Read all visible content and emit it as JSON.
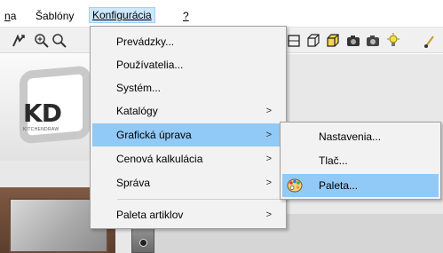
{
  "menubar": {
    "items": [
      {
        "label": "na",
        "underline": "n"
      },
      {
        "label": "Šablóny",
        "underline": "b"
      },
      {
        "label": "Konfigurácia",
        "underline": "K"
      },
      {
        "label": "?",
        "underline": "?"
      }
    ]
  },
  "toolbar": {
    "left_icons": [
      "arrow-split-icon",
      "zoom-in-icon",
      "zoom-out-icon"
    ],
    "right_icons": [
      "box-icon",
      "cube-icon",
      "cube-yellow-icon",
      "camera-icon",
      "camera-icon",
      "lightbulb-icon",
      "brush-icon"
    ]
  },
  "workspace": {
    "logo_text": "KD",
    "logo_sub": "KITCHENDRAW"
  },
  "config_menu": {
    "items": [
      {
        "label": "Prevádzky...",
        "submenu": false
      },
      {
        "label": "Používatelia...",
        "submenu": false
      },
      {
        "label": "Systém...",
        "submenu": false
      },
      {
        "label": "Katalógy",
        "submenu": true
      },
      {
        "label": "Grafická úprava",
        "submenu": true,
        "highlighted": true
      },
      {
        "label": "Cenová kalkulácia",
        "submenu": true
      },
      {
        "label": "Správa",
        "submenu": true
      },
      {
        "label": "Paleta artiklov",
        "submenu": true
      }
    ],
    "arrow_glyph": ">"
  },
  "graphics_submenu": {
    "items": [
      {
        "label": "Nastavenia...",
        "icon": ""
      },
      {
        "label": "Tlač...",
        "icon": ""
      },
      {
        "label": "Paleta...",
        "icon": "palette-icon",
        "highlighted": true
      }
    ]
  },
  "colors": {
    "menu_bg": "#f2f2f2",
    "highlight": "#91c9f7",
    "menubar_active": "#cce8ff"
  }
}
